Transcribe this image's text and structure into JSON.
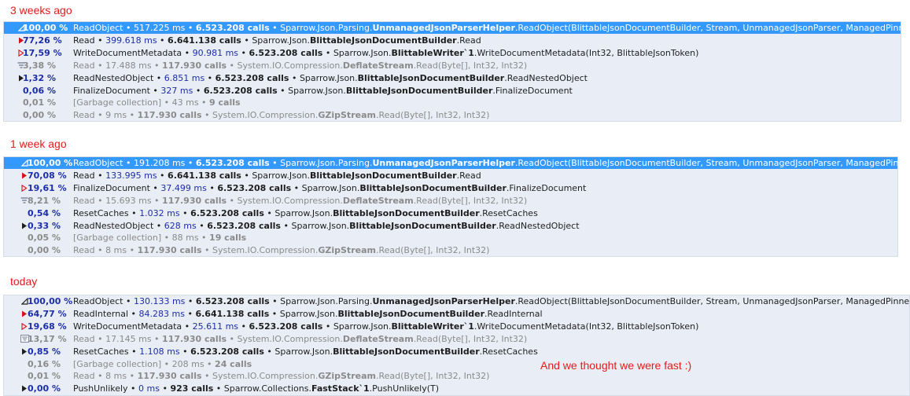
{
  "colors": {
    "heading": "#e51a1a",
    "selection": "#3399ff",
    "panel_bg": "#e9eef6",
    "percent": "#1c2ea8",
    "dim": "#8a8a8a",
    "hot_icon": "#d0141a"
  },
  "snapshots": [
    {
      "heading": "3 weeks ago",
      "rows": [
        {
          "icon": "collapse-triangle-icon",
          "pct": "100,00 %",
          "label": "ReadObject",
          "time": "517.225 ms",
          "calls": "6.523.208 calls",
          "ns": "Sparrow.Json.Parsing.",
          "cls": "UnmanagedJsonParserHelper",
          "rest": ".ReadObject(BlittableJsonDocumentBuilder, Stream, UnmanagedJsonParser, ManagedPinnedBuff...",
          "selected": true
        },
        {
          "icon": "hot-expand-arrow-icon",
          "pct": "77,26 %",
          "label": "Read",
          "time": "399.618 ms",
          "calls": "6.641.138 calls",
          "ns": "Sparrow.Json.",
          "cls": "BlittableJsonDocumentBuilder",
          "rest": ".Read"
        },
        {
          "icon": "hot-expand-outline-arrow-icon",
          "pct": "17,59 %",
          "label": "WriteDocumentMetadata",
          "time": "90.981 ms",
          "calls": "6.523.208 calls",
          "ns": "Sparrow.Json.",
          "cls": "BlittableWriter`1",
          "rest": ".WriteDocumentMetadata(Int32, BlittableJsonToken)"
        },
        {
          "icon": "filter-icon",
          "pct": "3,38 %",
          "label": "Read",
          "time": "17.488 ms",
          "calls": "117.930 calls",
          "ns": "System.IO.Compression.",
          "cls": "DeflateStream",
          "rest": ".Read(Byte[], Int32, Int32)",
          "dim": true
        },
        {
          "icon": "expand-arrow-icon",
          "pct": "1,32 %",
          "label": "ReadNestedObject",
          "time": "6.851 ms",
          "calls": "6.523.208 calls",
          "ns": "Sparrow.Json.",
          "cls": "BlittableJsonDocumentBuilder",
          "rest": ".ReadNestedObject"
        },
        {
          "icon": "",
          "pct": "0,06 %",
          "label": "FinalizeDocument",
          "time": "327 ms",
          "calls": "6.523.208 calls",
          "ns": "Sparrow.Json.",
          "cls": "BlittableJsonDocumentBuilder",
          "rest": ".FinalizeDocument"
        },
        {
          "icon": "",
          "pct": "0,01 %",
          "label": "[Garbage collection]",
          "time": "43 ms",
          "calls": "9 calls",
          "ns": "",
          "cls": "",
          "rest": "",
          "dim": true
        },
        {
          "icon": "",
          "pct": "0,00 %",
          "label": "Read",
          "time": "9 ms",
          "calls": "117.930 calls",
          "ns": "System.IO.Compression.",
          "cls": "GZipStream",
          "rest": ".Read(Byte[], Int32, Int32)",
          "dim": true
        }
      ]
    },
    {
      "heading": "1 week ago",
      "rows": [
        {
          "icon": "collapse-triangle-icon",
          "pct": "100,00 %",
          "label": "ReadObject",
          "time": "191.208 ms",
          "calls": "6.523.208 calls",
          "ns": "Sparrow.Json.Parsing.",
          "cls": "UnmanagedJsonParserHelper",
          "rest": ".ReadObject(BlittableJsonDocumentBuilder, Stream, UnmanagedJsonParser, ManagedPinnedBuffer)",
          "selected": true
        },
        {
          "icon": "hot-expand-arrow-icon",
          "pct": "70,08 %",
          "label": "Read",
          "time": "133.995 ms",
          "calls": "6.641.138 calls",
          "ns": "Sparrow.Json.",
          "cls": "BlittableJsonDocumentBuilder",
          "rest": ".Read"
        },
        {
          "icon": "hot-expand-outline-arrow-icon",
          "pct": "19,61 %",
          "label": "FinalizeDocument",
          "time": "37.499 ms",
          "calls": "6.523.208 calls",
          "ns": "Sparrow.Json.",
          "cls": "BlittableJsonDocumentBuilder",
          "rest": ".FinalizeDocument"
        },
        {
          "icon": "filter-icon",
          "pct": "8,21 %",
          "label": "Read",
          "time": "15.693 ms",
          "calls": "117.930 calls",
          "ns": "System.IO.Compression.",
          "cls": "DeflateStream",
          "rest": ".Read(Byte[], Int32, Int32)",
          "dim": true
        },
        {
          "icon": "",
          "pct": "0,54 %",
          "label": "ResetCaches",
          "time": "1.032 ms",
          "calls": "6.523.208 calls",
          "ns": "Sparrow.Json.",
          "cls": "BlittableJsonDocumentBuilder",
          "rest": ".ResetCaches"
        },
        {
          "icon": "expand-arrow-icon",
          "pct": "0,33 %",
          "label": "ReadNestedObject",
          "time": "628 ms",
          "calls": "6.523.208 calls",
          "ns": "Sparrow.Json.",
          "cls": "BlittableJsonDocumentBuilder",
          "rest": ".ReadNestedObject"
        },
        {
          "icon": "",
          "pct": "0,05 %",
          "label": "[Garbage collection]",
          "time": "88 ms",
          "calls": "19 calls",
          "ns": "",
          "cls": "",
          "rest": "",
          "dim": true
        },
        {
          "icon": "",
          "pct": "0,00 %",
          "label": "Read",
          "time": "8 ms",
          "calls": "117.930 calls",
          "ns": "System.IO.Compression.",
          "cls": "GZipStream",
          "rest": ".Read(Byte[], Int32, Int32)",
          "dim": true
        }
      ]
    },
    {
      "heading": "today",
      "rows": [
        {
          "icon": "collapse-triangle-icon",
          "pct": "100,00 %",
          "label": "ReadObject",
          "time": "130.133 ms",
          "calls": "6.523.208 calls",
          "ns": "Sparrow.Json.Parsing.",
          "cls": "UnmanagedJsonParserHelper",
          "rest": ".ReadObject(BlittableJsonDocumentBuilder, Stream, UnmanagedJsonParser, ManagedPinnedBuffer)"
        },
        {
          "icon": "hot-expand-arrow-icon",
          "pct": "64,77 %",
          "label": "ReadInternal",
          "time": "84.283 ms",
          "calls": "6.641.138 calls",
          "ns": "Sparrow.Json.",
          "cls": "BlittableJsonDocumentBuilder",
          "rest": ".ReadInternal"
        },
        {
          "icon": "hot-expand-outline-arrow-icon",
          "pct": "19,68 %",
          "label": "WriteDocumentMetadata",
          "time": "25.611 ms",
          "calls": "6.523.208 calls",
          "ns": "Sparrow.Json.",
          "cls": "BlittableWriter`1",
          "rest": ".WriteDocumentMetadata(Int32, BlittableJsonToken)"
        },
        {
          "icon": "filter-box-icon",
          "pct": "13,17 %",
          "label": "Read",
          "time": "17.145 ms",
          "calls": "117.930 calls",
          "ns": "System.IO.Compression.",
          "cls": "DeflateStream",
          "rest": ".Read(Byte[], Int32, Int32)",
          "dim": true
        },
        {
          "icon": "expand-arrow-icon",
          "pct": "0,85 %",
          "label": "ResetCaches",
          "time": "1.108 ms",
          "calls": "6.523.208 calls",
          "ns": "Sparrow.Json.",
          "cls": "BlittableJsonDocumentBuilder",
          "rest": ".ResetCaches"
        },
        {
          "icon": "",
          "pct": "0,16 %",
          "label": "[Garbage collection]",
          "time": "208 ms",
          "calls": "24 calls",
          "ns": "",
          "cls": "",
          "rest": "",
          "dim": true
        },
        {
          "icon": "",
          "pct": "0,01 %",
          "label": "Read",
          "time": "8 ms",
          "calls": "117.930 calls",
          "ns": "System.IO.Compression.",
          "cls": "GZipStream",
          "rest": ".Read(Byte[], Int32, Int32)",
          "dim": true
        },
        {
          "icon": "expand-arrow-icon",
          "pct": "0,00 %",
          "label": "PushUnlikely",
          "time": "0 ms",
          "calls": "923 calls",
          "ns": "Sparrow.Collections.",
          "cls": "FastStack`1",
          "rest": ".PushUnlikely(T)"
        }
      ]
    }
  ],
  "note": "And we thought we were fast :)"
}
